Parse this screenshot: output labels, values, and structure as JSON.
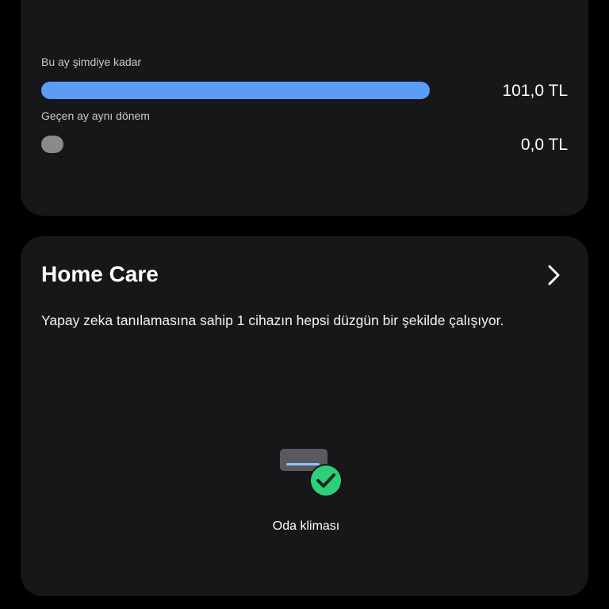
{
  "energy": {
    "this_month": {
      "label": "Bu ay şimdiye kadar",
      "amount": "101,0 TL",
      "value": 101.0
    },
    "previous_period": {
      "label": "Geçen ay aynı dönem",
      "amount": "0,0 TL",
      "value": 0.0
    }
  },
  "home_care": {
    "title": "Home Care",
    "description": "Yapay zeka tanılamasına sahip 1 cihazın hepsi düzgün bir şekilde çalışıyor.",
    "devices": [
      {
        "name": "Oda kliması",
        "icon": "air-conditioner-icon",
        "status": "ok",
        "status_icon": "check-circle-icon"
      }
    ]
  },
  "colors": {
    "background": "#000000",
    "card": "#171719",
    "bar_current": "#5b9cf8",
    "bar_previous": "#8a8a8d",
    "status_ok": "#2ecf7a"
  }
}
